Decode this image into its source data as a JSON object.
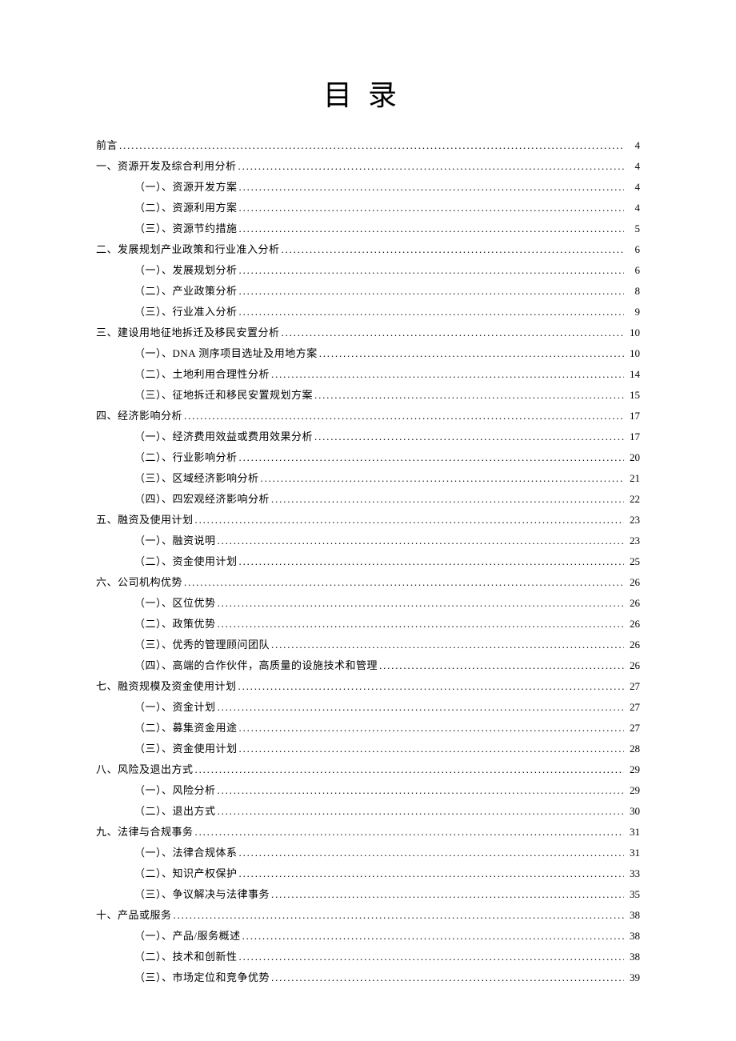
{
  "title": "目录",
  "entries": [
    {
      "level": 1,
      "label": "前言",
      "page": "4"
    },
    {
      "level": 1,
      "label": "一、资源开发及综合利用分析",
      "page": "4"
    },
    {
      "level": 2,
      "label": "（一）、资源开发方案",
      "page": "4"
    },
    {
      "level": 2,
      "label": "（二）、资源利用方案",
      "page": "4"
    },
    {
      "level": 2,
      "label": "（三）、资源节约措施",
      "page": "5"
    },
    {
      "level": 1,
      "label": "二、发展规划产业政策和行业准入分析",
      "page": "6"
    },
    {
      "level": 2,
      "label": "（一）、发展规划分析",
      "page": "6"
    },
    {
      "level": 2,
      "label": "（二）、产业政策分析",
      "page": "8"
    },
    {
      "level": 2,
      "label": "（三）、行业准入分析",
      "page": "9"
    },
    {
      "level": 1,
      "label": "三、建设用地征地拆迁及移民安置分析",
      "page": "10"
    },
    {
      "level": 2,
      "label": "（一）、DNA 测序项目选址及用地方案",
      "page": "10"
    },
    {
      "level": 2,
      "label": "（二）、土地利用合理性分析",
      "page": "14"
    },
    {
      "level": 2,
      "label": "（三）、征地拆迁和移民安置规划方案",
      "page": "15"
    },
    {
      "level": 1,
      "label": "四、经济影响分析",
      "page": "17"
    },
    {
      "level": 2,
      "label": "（一）、经济费用效益或费用效果分析",
      "page": "17"
    },
    {
      "level": 2,
      "label": "（二）、行业影响分析",
      "page": "20"
    },
    {
      "level": 2,
      "label": "（三）、区域经济影响分析",
      "page": "21"
    },
    {
      "level": 2,
      "label": "（四）、四宏观经济影响分析",
      "page": "22"
    },
    {
      "level": 1,
      "label": "五、融资及使用计划",
      "page": "23"
    },
    {
      "level": 2,
      "label": "（一）、融资说明",
      "page": "23"
    },
    {
      "level": 2,
      "label": "（二）、资金使用计划",
      "page": "25"
    },
    {
      "level": 1,
      "label": "六、公司机构优势",
      "page": "26"
    },
    {
      "level": 2,
      "label": "（一）、区位优势",
      "page": "26"
    },
    {
      "level": 2,
      "label": "（二）、政策优势",
      "page": "26"
    },
    {
      "level": 2,
      "label": "（三）、优秀的管理顾问团队",
      "page": "26"
    },
    {
      "level": 2,
      "label": "（四）、高端的合作伙伴，高质量的设施技术和管理",
      "page": "26"
    },
    {
      "level": 1,
      "label": "七、融资规模及资金使用计划",
      "page": "27"
    },
    {
      "level": 2,
      "label": "（一）、资金计划",
      "page": "27"
    },
    {
      "level": 2,
      "label": "（二）、募集资金用途",
      "page": "27"
    },
    {
      "level": 2,
      "label": "（三）、资金使用计划",
      "page": "28"
    },
    {
      "level": 1,
      "label": "八、风险及退出方式",
      "page": "29"
    },
    {
      "level": 2,
      "label": "（一）、风险分析",
      "page": "29"
    },
    {
      "level": 2,
      "label": "（二）、退出方式",
      "page": "30"
    },
    {
      "level": 1,
      "label": "九、法律与合规事务",
      "page": "31"
    },
    {
      "level": 2,
      "label": "（一）、法律合规体系",
      "page": "31"
    },
    {
      "level": 2,
      "label": "（二）、知识产权保护",
      "page": "33"
    },
    {
      "level": 2,
      "label": "（三）、争议解决与法律事务",
      "page": "35"
    },
    {
      "level": 1,
      "label": "十、产品或服务",
      "page": "38"
    },
    {
      "level": 2,
      "label": "（一）、产品/服务概述",
      "page": "38"
    },
    {
      "level": 2,
      "label": "（二）、技术和创新性",
      "page": "38"
    },
    {
      "level": 2,
      "label": "（三）、市场定位和竞争优势",
      "page": "39"
    }
  ]
}
